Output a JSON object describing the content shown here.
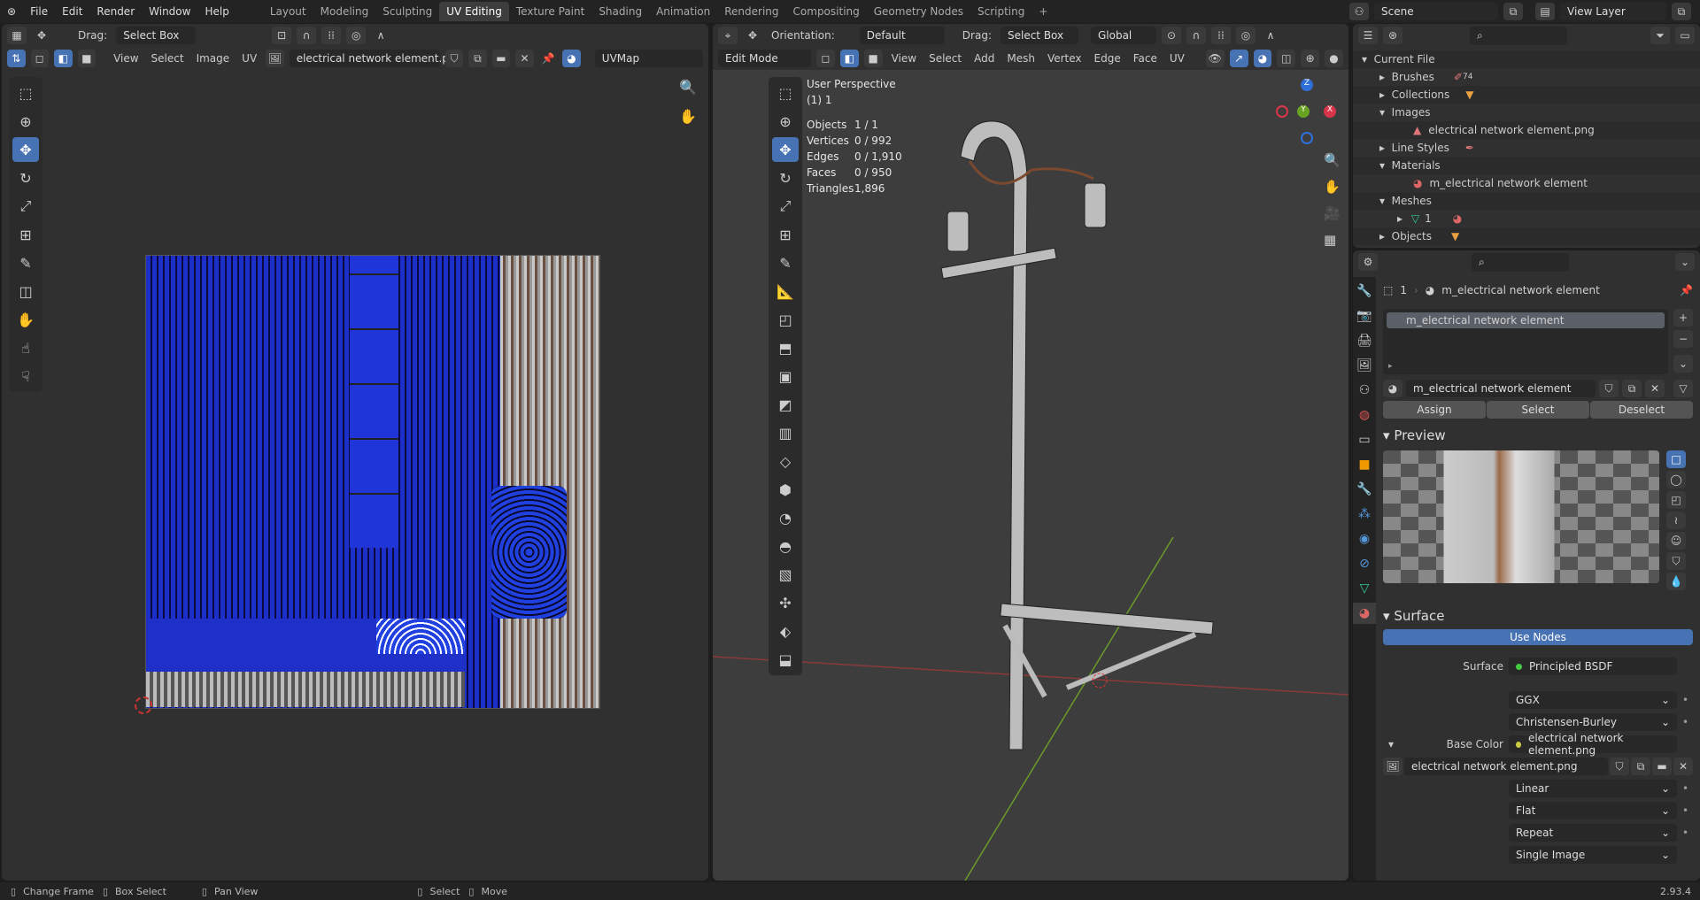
{
  "topbar": {
    "menus": [
      "File",
      "Edit",
      "Render",
      "Window",
      "Help"
    ],
    "workspaces": [
      "Layout",
      "Modeling",
      "Sculpting",
      "UV Editing",
      "Texture Paint",
      "Shading",
      "Animation",
      "Rendering",
      "Compositing",
      "Geometry Nodes",
      "Scripting"
    ],
    "active_workspace": "UV Editing",
    "scene": "Scene",
    "view_layer": "View Layer"
  },
  "uv_editor": {
    "drag_label": "Drag:",
    "drag_value": "Select Box",
    "menus": [
      "View",
      "Select",
      "Image",
      "UV"
    ],
    "image_name": "electrical network element.png",
    "uv_map": "UVMap"
  },
  "viewport": {
    "orientation_label": "Orientation:",
    "orientation_value": "Default",
    "drag_label": "Drag:",
    "drag_value": "Select Box",
    "transform": "Global",
    "mode": "Edit Mode",
    "menus": [
      "View",
      "Select",
      "Add",
      "Mesh",
      "Vertex",
      "Edge",
      "Face",
      "UV"
    ],
    "overlay": {
      "title": "User Perspective",
      "subtitle": "(1) 1",
      "stats": [
        {
          "k": "Objects",
          "v": "1 / 1"
        },
        {
          "k": "Vertices",
          "v": "0 / 992"
        },
        {
          "k": "Edges",
          "v": "0 / 1,910"
        },
        {
          "k": "Faces",
          "v": "0 / 950"
        },
        {
          "k": "Triangles",
          "v": "1,896"
        }
      ]
    },
    "gizmo": {
      "x": "X",
      "y": "Y",
      "z": "Z"
    }
  },
  "outliner": {
    "root": "Current File",
    "brush_count": "74",
    "items": [
      {
        "label": "Brushes",
        "expanded": false
      },
      {
        "label": "Collections",
        "expanded": false
      },
      {
        "label": "Images",
        "expanded": true,
        "child": "electrical network element.png"
      },
      {
        "label": "Line Styles",
        "expanded": false
      },
      {
        "label": "Materials",
        "expanded": true,
        "child": "m_electrical network element"
      },
      {
        "label": "Meshes",
        "expanded": true,
        "child": "1"
      },
      {
        "label": "Objects",
        "expanded": false
      }
    ]
  },
  "properties": {
    "breadcrumb_object": "1",
    "breadcrumb_material": "m_electrical network element",
    "slot": "m_electrical network element",
    "material_name": "m_electrical network element",
    "assign": "Assign",
    "select": "Select",
    "deselect": "Deselect",
    "preview_title": "Preview",
    "surface_title": "Surface",
    "use_nodes": "Use Nodes",
    "surface_label": "Surface",
    "surface_value": "Principled BSDF",
    "distribution": "GGX",
    "subsurface": "Christensen-Burley",
    "base_color_label": "Base Color",
    "base_color_value": "electrical network element.png",
    "image_name": "electrical network element.png",
    "interpolation": "Linear",
    "projection": "Flat",
    "extension": "Repeat",
    "source": "Single Image"
  },
  "statusbar": {
    "items": [
      "Change Frame",
      "Box Select",
      "Pan View",
      "Select",
      "Move"
    ],
    "version": "2.93.4"
  }
}
